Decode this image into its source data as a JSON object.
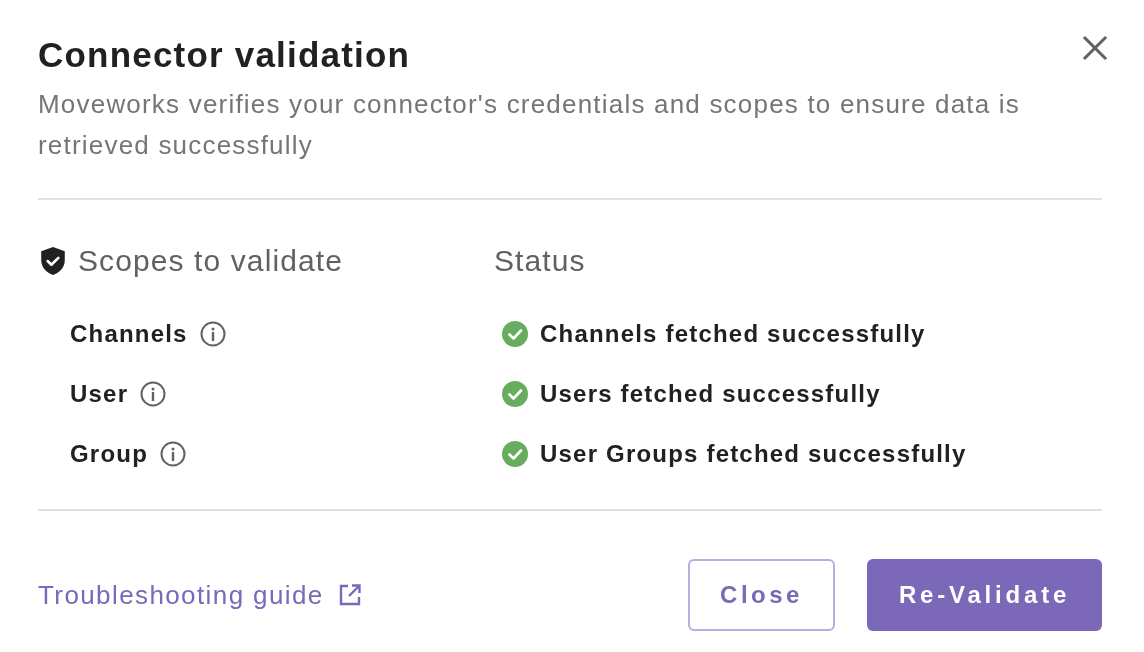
{
  "dialog": {
    "title": "Connector validation",
    "description": "Moveworks verifies your connector's credentials and scopes to ensure data is retrieved successfully"
  },
  "columns": {
    "scopes": "Scopes to validate",
    "status": "Status"
  },
  "scopes": [
    {
      "name": "Channels",
      "success": true,
      "message": "Channels fetched successfully"
    },
    {
      "name": "User",
      "success": true,
      "message": "Users fetched successfully"
    },
    {
      "name": "Group",
      "success": true,
      "message": "User Groups fetched successfully"
    }
  ],
  "footer": {
    "link": "Troubleshooting guide",
    "buttons": [
      {
        "label": "Close",
        "kind": "outlined"
      },
      {
        "label": "Re-Validate",
        "kind": "filled"
      }
    ]
  }
}
